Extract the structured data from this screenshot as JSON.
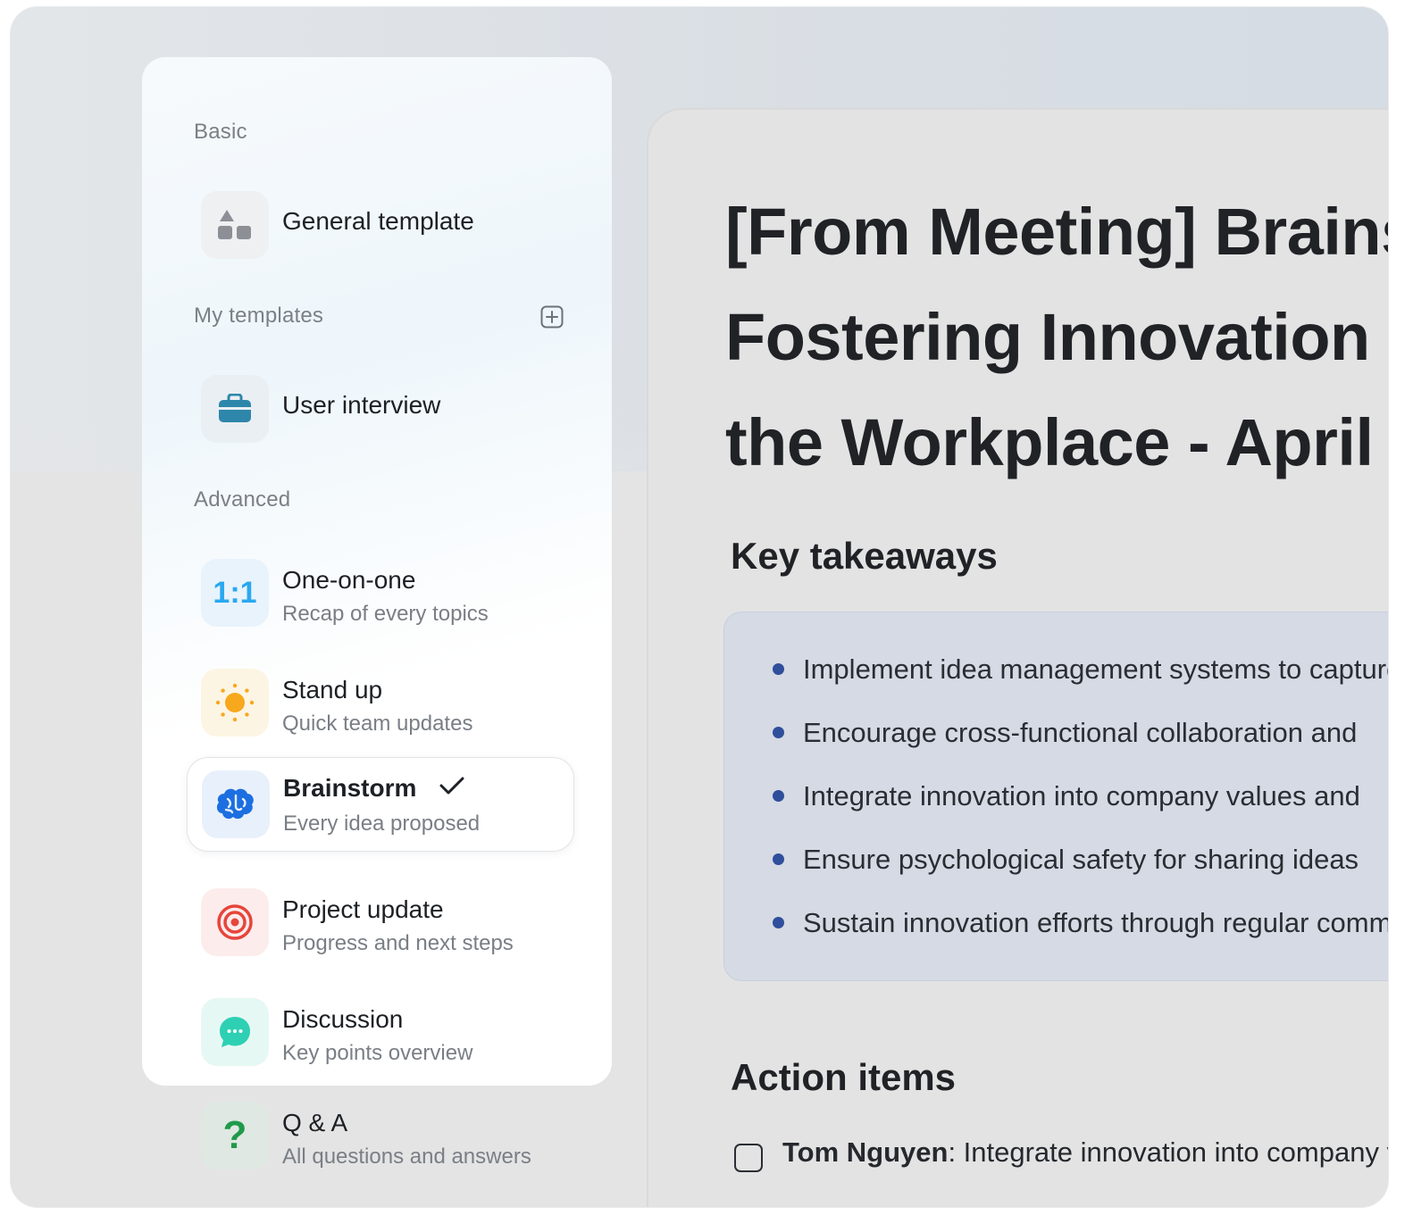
{
  "sidebar": {
    "sections": {
      "basic": "Basic",
      "my_templates": "My templates",
      "advanced": "Advanced"
    },
    "items": {
      "general": {
        "title": "General template",
        "icon": "shapes-icon"
      },
      "user_interview": {
        "title": "User interview",
        "icon": "briefcase-icon"
      },
      "one_on_one": {
        "title": "One-on-one",
        "subtitle": "Recap of every topics",
        "icon_text": "1:1"
      },
      "stand_up": {
        "title": "Stand up",
        "subtitle": "Quick team updates",
        "icon": "sun-icon"
      },
      "brainstorm": {
        "title": "Brainstorm",
        "subtitle": "Every idea proposed",
        "icon": "brain-icon",
        "selected": true
      },
      "project_update": {
        "title": "Project update",
        "subtitle": "Progress and next steps",
        "icon": "target-icon"
      },
      "discussion": {
        "title": "Discussion",
        "subtitle": "Key points overview",
        "icon": "chat-bubble-icon"
      },
      "qa": {
        "title": "Q & A",
        "subtitle": "All questions and answers",
        "icon_text": "?"
      }
    }
  },
  "document": {
    "title_lines": [
      "[From Meeting] Brainstorm:",
      "Fostering Innovation in",
      "the Workplace - April"
    ],
    "key_takeaways_heading": "Key takeaways",
    "key_takeaways": [
      "Implement idea management systems to capture",
      "Encourage cross-functional collaboration and",
      "Integrate innovation into company values and",
      "Ensure psychological safety for sharing ideas",
      "Sustain innovation efforts through regular communication"
    ],
    "action_items_heading": "Action items",
    "action_items": [
      {
        "assignee": "Tom Nguyen",
        "text": ": Integrate innovation into company values",
        "checked": false
      }
    ]
  },
  "colors": {
    "accent_blue": "#2f4e9b",
    "one_on_one_blue": "#2aa8f0",
    "sun_orange": "#f8a81c",
    "brain_blue": "#1c6fe0",
    "target_red": "#e6453a",
    "chat_teal": "#2ed0b4",
    "qa_green": "#1f9a4a"
  }
}
